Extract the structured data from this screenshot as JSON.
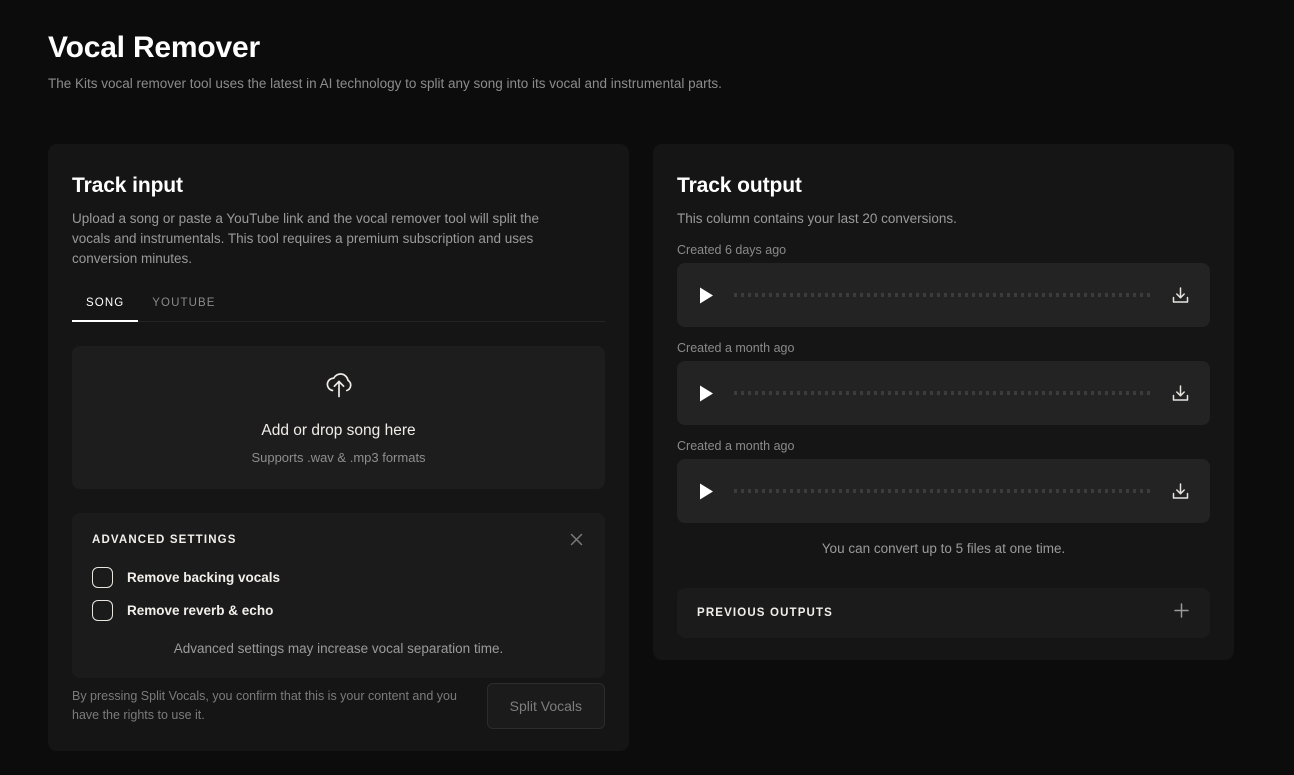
{
  "header": {
    "title": "Vocal Remover",
    "subtitle": "The Kits vocal remover tool uses the latest in AI technology to split any song into its vocal and instrumental parts."
  },
  "track_input": {
    "title": "Track input",
    "description": "Upload a song or paste a YouTube link and the vocal remover tool will split the vocals and instrumentals. This tool requires a premium subscription and uses conversion minutes.",
    "tabs": [
      {
        "label": "SONG",
        "active": true
      },
      {
        "label": "YOUTUBE",
        "active": false
      }
    ],
    "dropzone": {
      "icon": "cloud-upload-icon",
      "title": "Add or drop song here",
      "subtitle": "Supports .wav & .mp3 formats"
    },
    "advanced_settings": {
      "title": "ADVANCED SETTINGS",
      "close_icon": "close-icon",
      "options": [
        {
          "label": "Remove backing vocals",
          "checked": false
        },
        {
          "label": "Remove reverb & echo",
          "checked": false
        }
      ],
      "note": "Advanced settings may increase vocal separation time."
    },
    "footer": {
      "terms": "By pressing Split Vocals, you confirm that this is your content and you have the rights to use it.",
      "submit_label": "Split Vocals",
      "submit_disabled": true
    }
  },
  "track_output": {
    "title": "Track output",
    "description": "This column contains your last 20 conversions.",
    "items": [
      {
        "created": "Created 6 days ago",
        "play_icon": "play-icon",
        "download_icon": "download-icon"
      },
      {
        "created": "Created a month ago",
        "play_icon": "play-icon",
        "download_icon": "download-icon"
      },
      {
        "created": "Created a month ago",
        "play_icon": "play-icon",
        "download_icon": "download-icon"
      }
    ],
    "limit_note": "You can convert up to 5 files at one time.",
    "previous_outputs": {
      "label": "PREVIOUS OUTPUTS",
      "expand_icon": "plus-icon"
    }
  },
  "colors": {
    "page_background": "#0c0c0c",
    "card_background": "#151515",
    "panel_background": "#1b1b1b",
    "player_background": "#232323",
    "text_primary": "#ffffff",
    "text_muted": "#8c8c8c"
  }
}
